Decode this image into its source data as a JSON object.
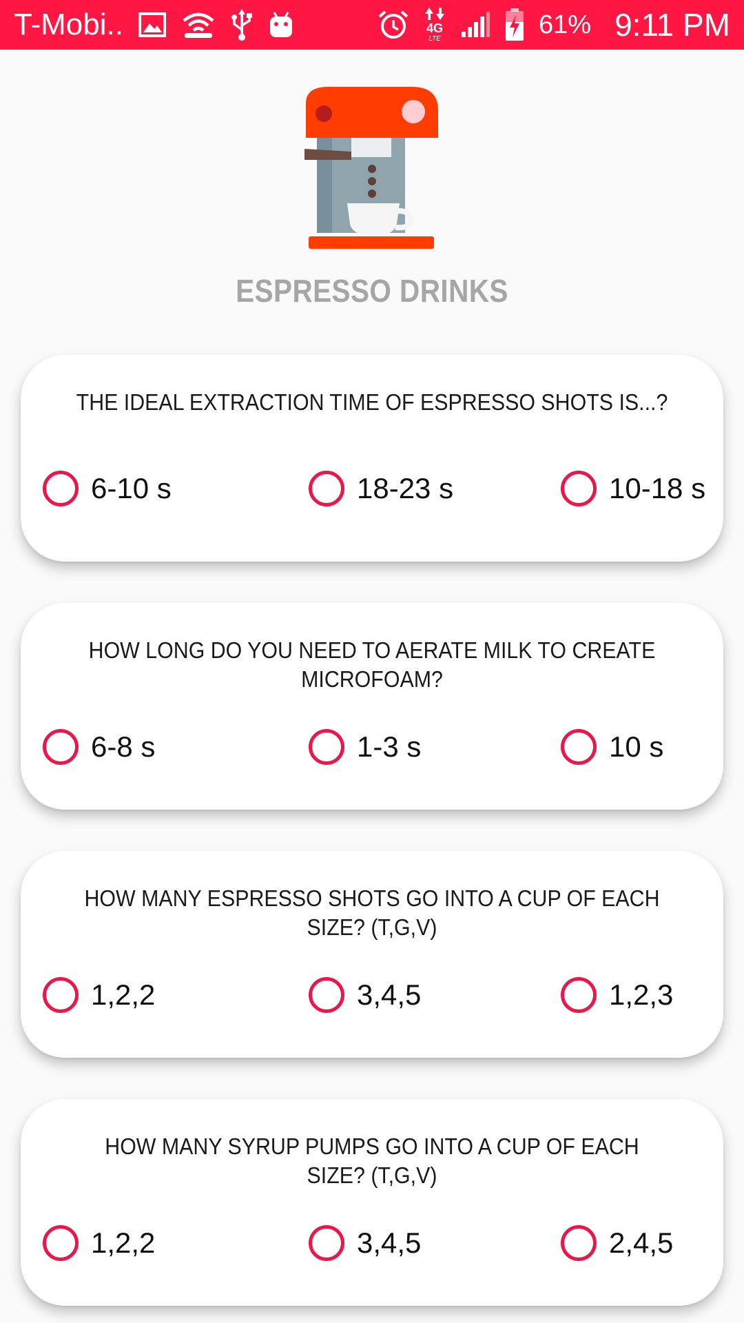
{
  "status_bar": {
    "carrier": "T-Mobi..",
    "network": "4G",
    "battery_percent": "61%",
    "time": "9:11 PM",
    "background_color": "#ff1744",
    "icons": [
      "image-icon",
      "wifi-hotspot-icon",
      "usb-icon",
      "android-icon",
      "alarm-icon",
      "data-arrows-icon",
      "signal-icon",
      "battery-charging-icon"
    ]
  },
  "header": {
    "illustration": "espresso-machine-icon",
    "title": "ESPRESSO DRINKS"
  },
  "questions": [
    {
      "text": "THE IDEAL EXTRACTION TIME OF ESPRESSO SHOTS IS...?",
      "options": [
        "6-10 s",
        "18-23 s",
        "10-18 s"
      ]
    },
    {
      "text": "HOW LONG DO YOU NEED TO AERATE MILK TO CREATE MICROFOAM?",
      "options": [
        "6-8 s",
        "1-3 s",
        "10 s"
      ]
    },
    {
      "text": "HOW MANY ESPRESSO SHOTS GO INTO A CUP OF EACH SIZE? (T,G,V)",
      "options": [
        "1,2,2",
        "3,4,5",
        "1,2,3"
      ]
    },
    {
      "text": "HOW MANY SYRUP PUMPS GO INTO A CUP OF EACH SIZE? (T,G,V)",
      "options": [
        "1,2,2",
        "3,4,5",
        "2,4,5"
      ]
    }
  ],
  "colors": {
    "accent": "#ea1848",
    "title_gray": "#a6a6a6",
    "card_bg": "#ffffff",
    "page_bg": "#fafafa"
  }
}
